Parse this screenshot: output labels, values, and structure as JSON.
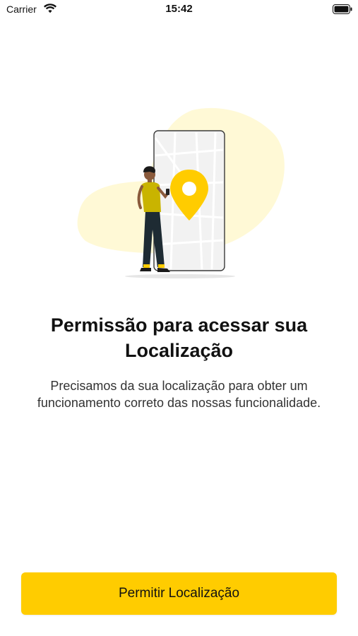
{
  "status_bar": {
    "carrier": "Carrier",
    "time": "15:42",
    "icons": [
      "wifi-icon",
      "battery-icon"
    ]
  },
  "illustration": {
    "name": "location-permission-illustration",
    "accent_color": "#FFCC00",
    "blob_color": "#FFF9D6"
  },
  "permission": {
    "title": "Permissão para acessar sua Localização",
    "description": "Precisamos da sua localização para obter um funcionamento correto das nossas funcionalidade."
  },
  "button": {
    "label": "Permitir Localização",
    "color": "#FFCC00"
  }
}
